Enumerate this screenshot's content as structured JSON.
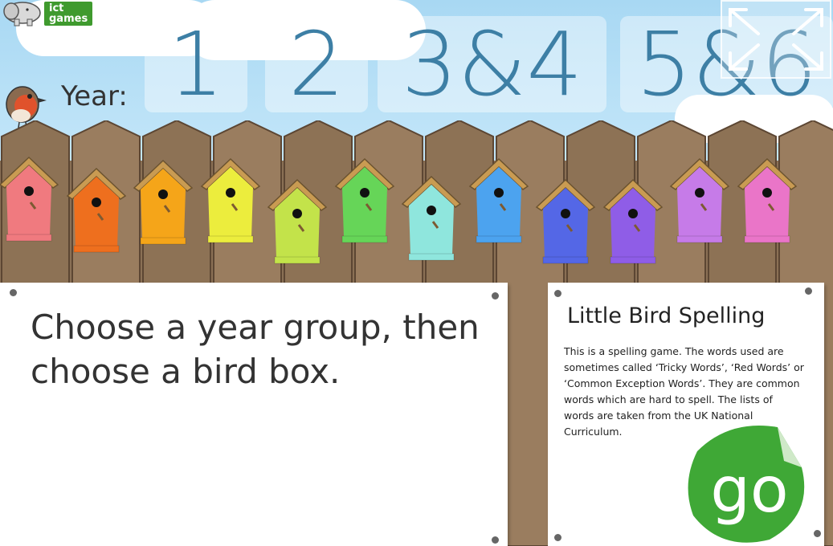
{
  "logo": {
    "line1": "ict",
    "line2": "games"
  },
  "year": {
    "label": "Year:",
    "buttons": [
      {
        "label": "1"
      },
      {
        "label": "2"
      },
      {
        "label": "3&4"
      },
      {
        "label": "5&6"
      }
    ]
  },
  "birdboxes": [
    {
      "color": "#f07a7f"
    },
    {
      "color": "#ee6f1e"
    },
    {
      "color": "#f5a519"
    },
    {
      "color": "#eced3d"
    },
    {
      "color": "#c3e34a"
    },
    {
      "color": "#66d558"
    },
    {
      "color": "#8fe6dd"
    },
    {
      "color": "#4ca3ef"
    },
    {
      "color": "#5467e6"
    },
    {
      "color": "#8f5de7"
    },
    {
      "color": "#c67be8"
    },
    {
      "color": "#ea75c8"
    }
  ],
  "instructions": {
    "text": "Choose a year group, then choose a bird box."
  },
  "info": {
    "title": "Little Bird Spelling",
    "text": "This is a spelling game. The words used are sometimes called ‘Tricky Words’, ‘Red Words’ or ‘Common Exception Words’. They are common words which are hard to spell. The lists of words are taken from the UK National Curriculum."
  },
  "go": {
    "label": "go",
    "color": "#3fa836"
  }
}
